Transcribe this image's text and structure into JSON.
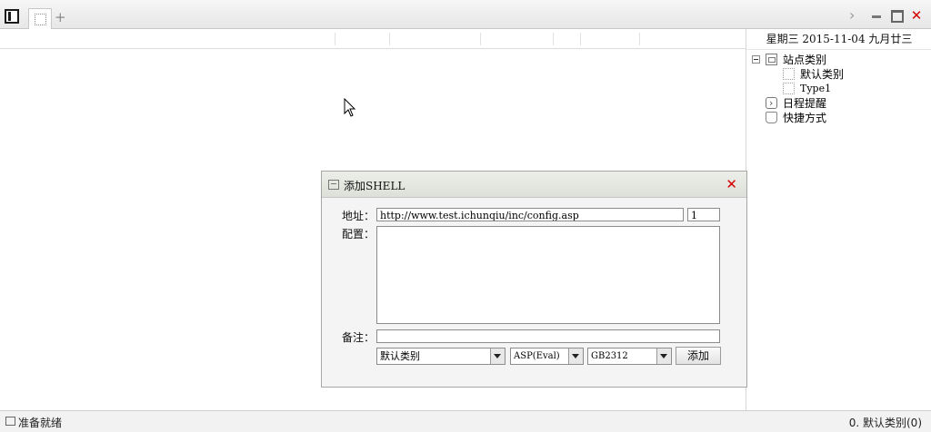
{
  "tabbar": {
    "panel_icon": "panel-toggle-icon",
    "tab_icon": "blank-page-icon",
    "add_label": "+",
    "window_controls": {
      "scroll_right": "chevron-right-icon",
      "minimize": "minimize-icon",
      "maximize": "maximize-icon",
      "close": "close-icon"
    }
  },
  "header": {
    "date_text": "星期三 2015-11-04 九月廿三"
  },
  "tree": {
    "root": {
      "label": "站点类别",
      "icon": "site-folder-icon"
    },
    "children": [
      {
        "label": "默认类别",
        "icon": "category-icon"
      },
      {
        "label": "Type1",
        "icon": "category-icon"
      }
    ],
    "schedule": {
      "label": "日程提醒",
      "icon": "schedule-icon"
    },
    "shortcut": {
      "label": "快捷方式",
      "icon": "shortcut-hand-icon"
    }
  },
  "dialog": {
    "title": "添加SHELL",
    "address_label": "地址：",
    "address_value": "http://www.test.ichunqiu/inc/config.asp",
    "password_value": "1",
    "config_label": "配置：",
    "config_value": "",
    "note_label": "备注：",
    "note_value": "",
    "category_value": "默认类别",
    "script_type_value": "ASP(Eval)",
    "encoding_value": "GB2312",
    "add_button": "添加"
  },
  "status": {
    "left_text": "准备就绪",
    "right_text": "0. 默认类别(0)"
  },
  "colors": {
    "close_red": "#d40000"
  }
}
